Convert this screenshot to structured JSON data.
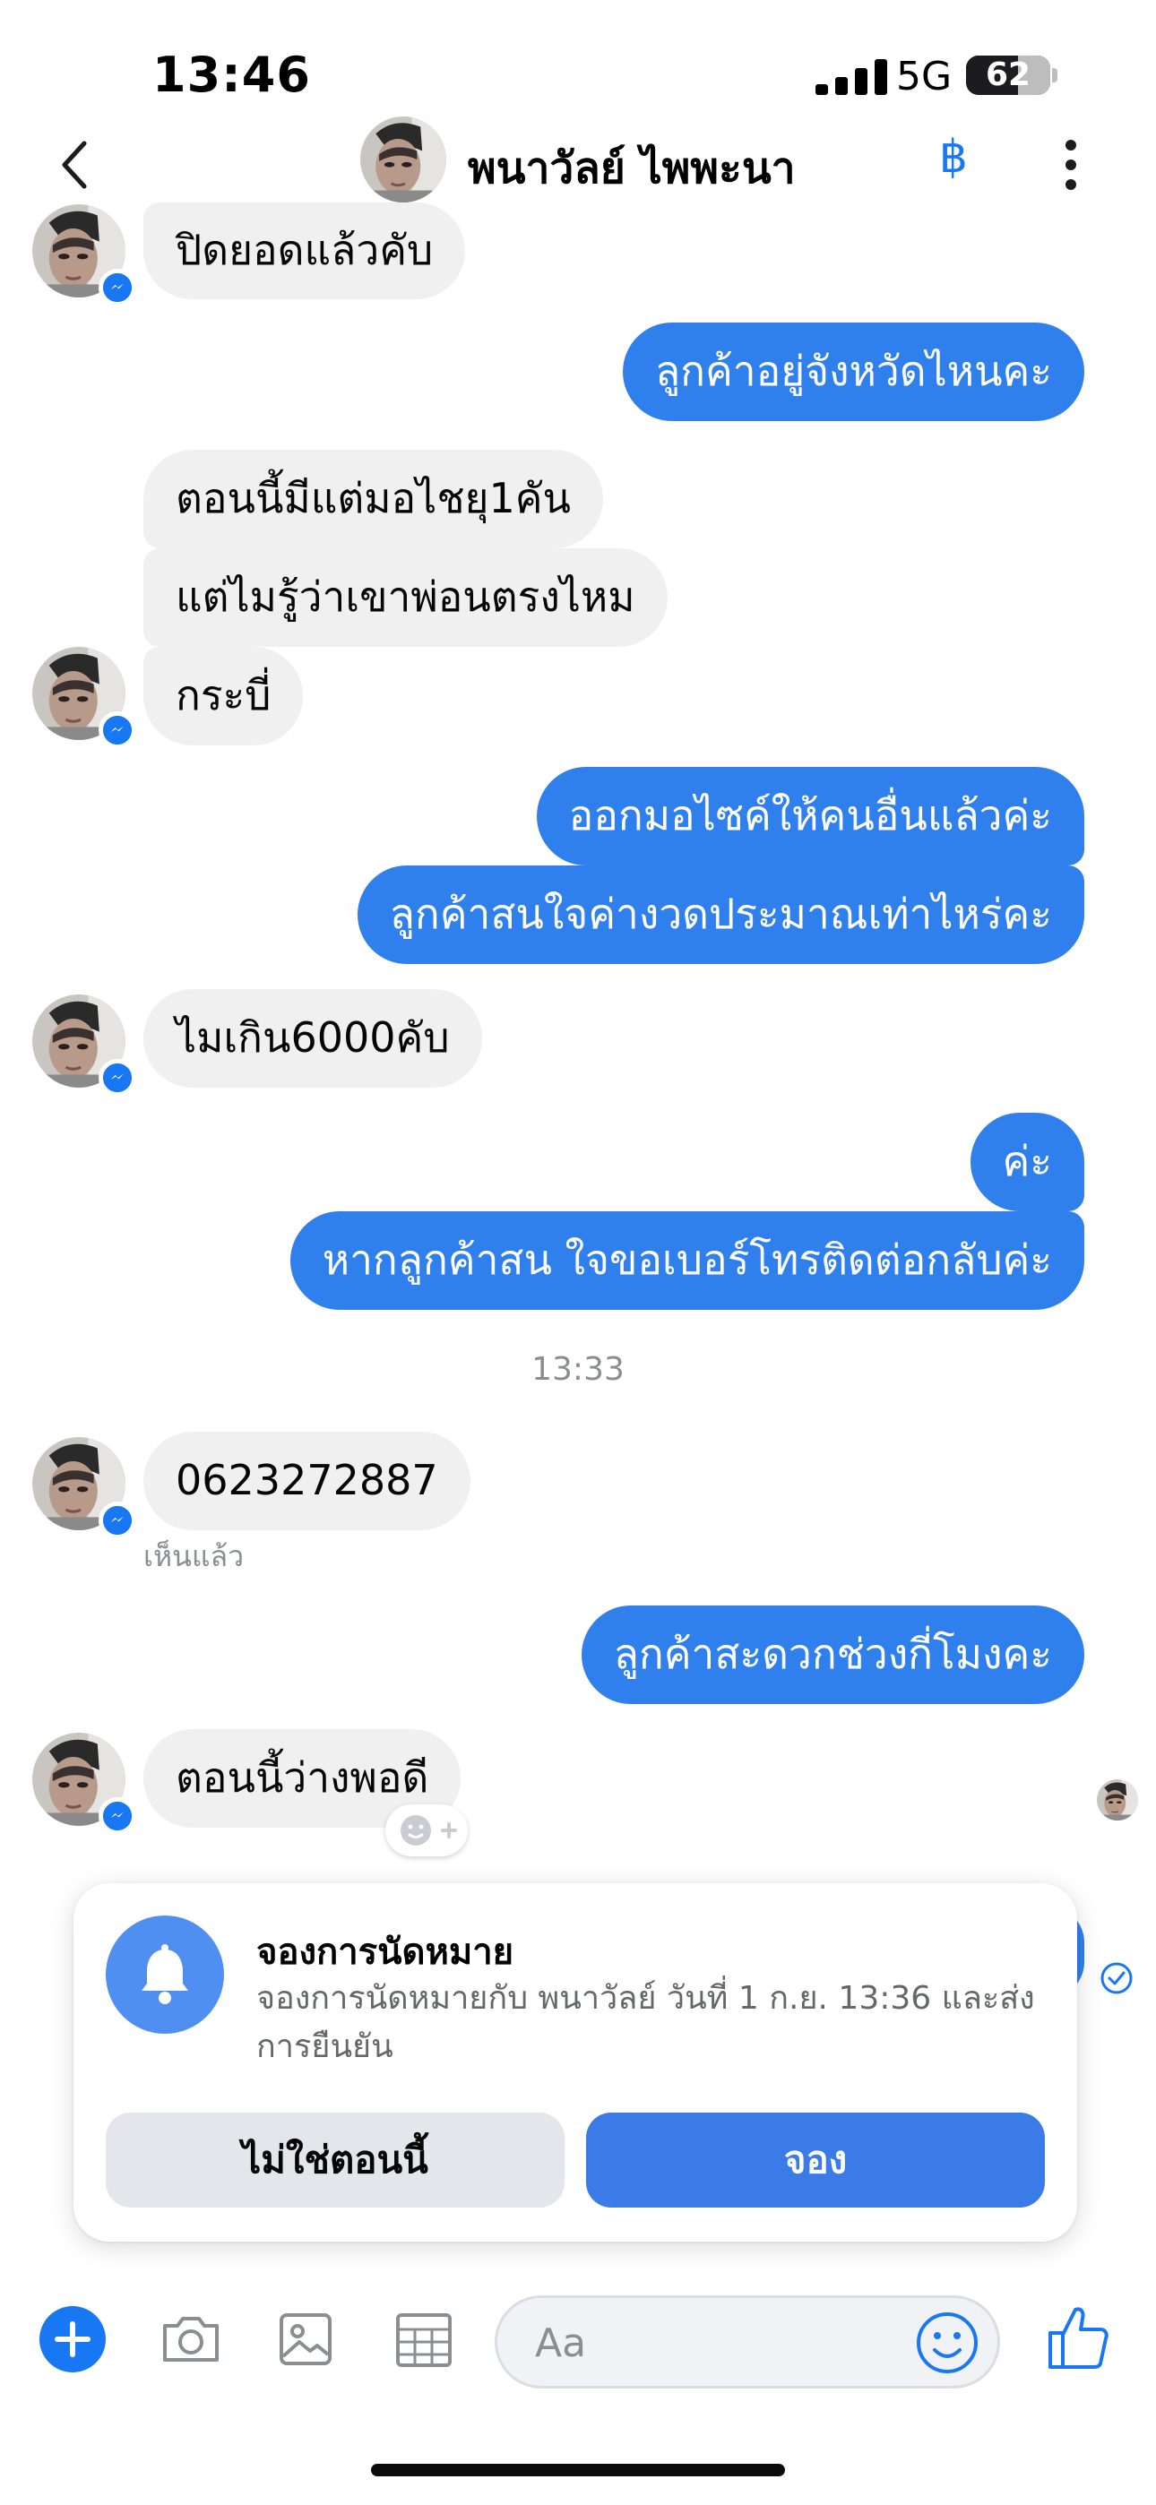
{
  "status_bar": {
    "time": "13:46",
    "network": "5G",
    "battery": "62",
    "battery_level": 0.62
  },
  "header": {
    "contact_name": "พนาวัลย์ ไพพะนา",
    "baht_icon": "฿"
  },
  "messages": {
    "m1": "ปิดยอดแล้วคับ",
    "m2": "ลูกค้าอยู่จังหวัดไหนคะ",
    "m3": "ตอนนี้มีแต่มอไชยุ1คัน",
    "m4": "แต่ไมรู้ว่าเขาพ่อนตรงไหม",
    "m5": "กระบี่",
    "m6": "ออกมอไซค์ให้คนอื่นแล้วค่ะ",
    "m7": "ลูกค้าสนใจค่างวดประมาณเท่าไหร่คะ",
    "m8": "ไมเกิน6000คับ",
    "m9": "ค่ะ",
    "m10": "หากลูกค้าสน ใจขอเบอร์โทรติดต่อกลับค่ะ",
    "m11": "0623272887",
    "m12": "ลูกค้าสะดวกช่วงกี่โมงคะ",
    "m13": "ตอนนี้ว่างพอดี"
  },
  "timestamp": "13:33",
  "seen_label": "เห็นแล้ว",
  "reminder_card": {
    "title": "จองการนัดหมาย",
    "body": "จองการนัดหมายกับ พนาวัลย์ วันที่ 1 ก.ย. 13:36 และส่งการยืนยัน",
    "decline_label": "ไม่ใช่ตอนนี้",
    "confirm_label": "จอง"
  },
  "composer": {
    "placeholder": "Aa"
  },
  "colors": {
    "outgoing_bubble": "#2f80ed",
    "incoming_bubble": "#f0f0f0",
    "accent": "#1877f2",
    "primary_button": "#3b7be8"
  },
  "icons": [
    "back-icon",
    "baht-icon",
    "more-icon",
    "messenger-badge-icon",
    "reaction-add-icon",
    "bell-icon",
    "plus-icon",
    "camera-icon",
    "image-icon",
    "calendar-icon",
    "emoji-icon",
    "like-icon",
    "sent-check-icon"
  ]
}
